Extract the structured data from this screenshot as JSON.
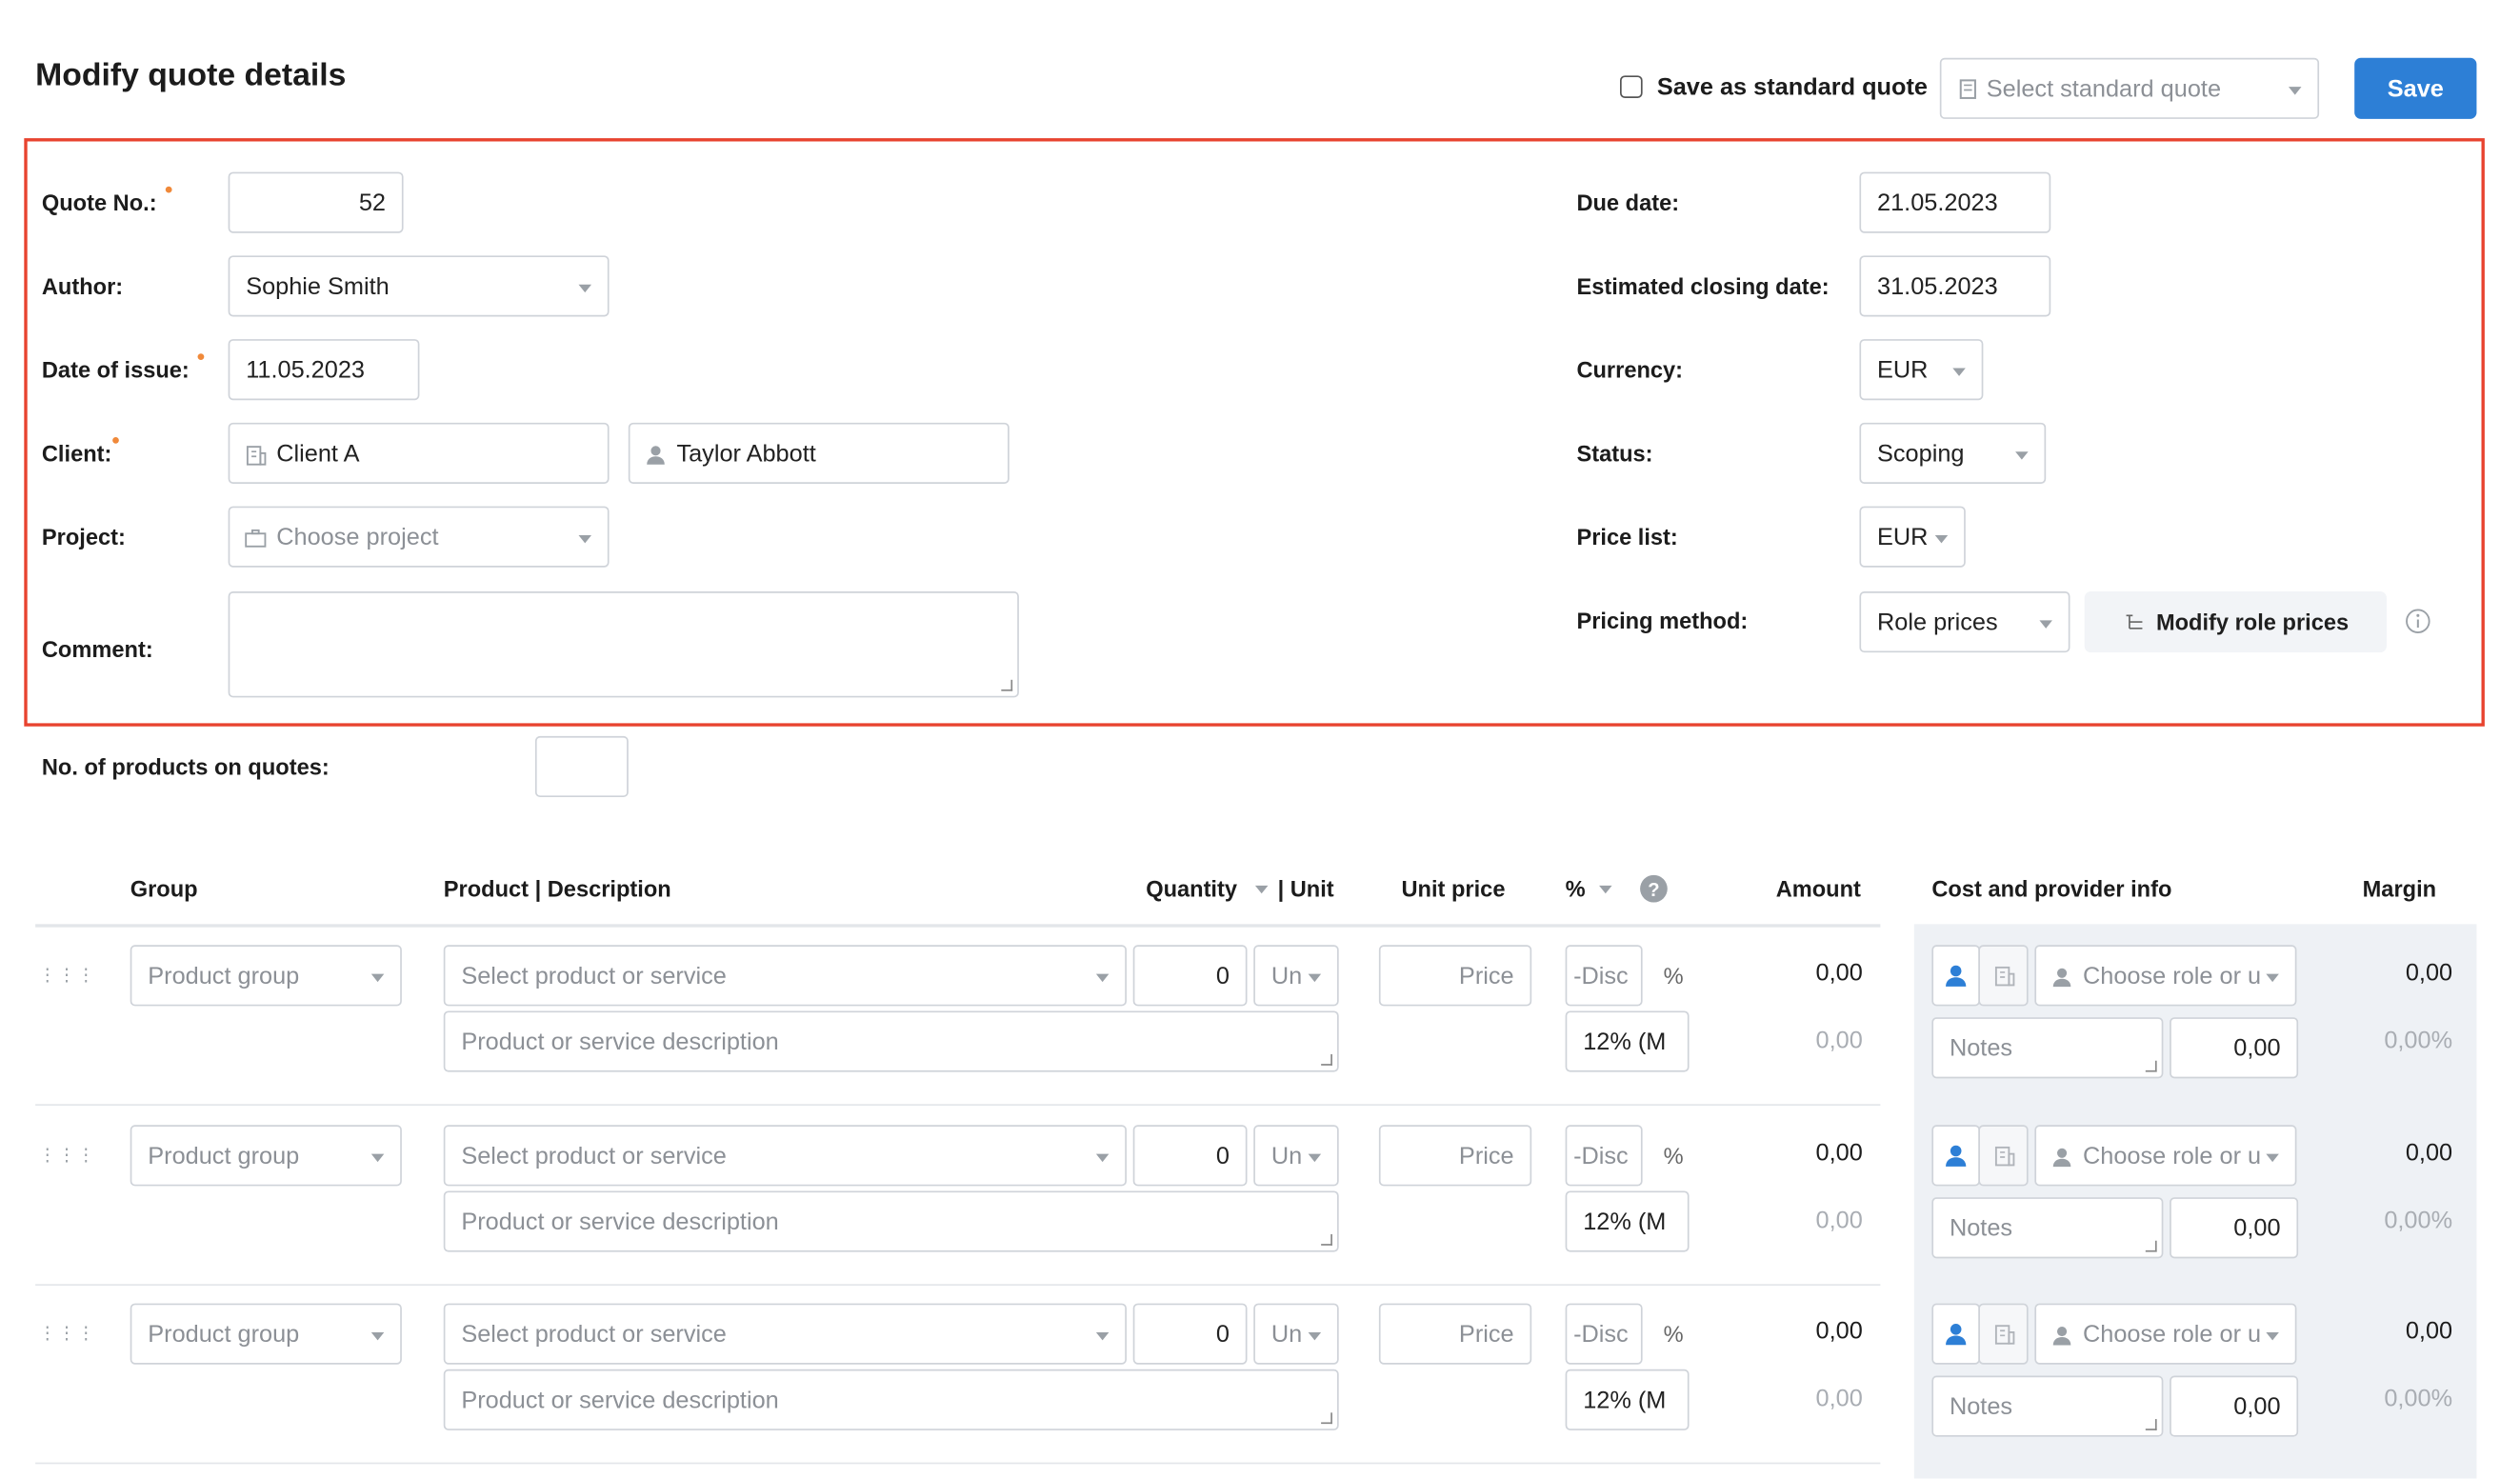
{
  "header": {
    "title": "Modify quote details",
    "save_standard_label": "Save as standard quote",
    "select_standard_placeholder": "Select standard quote",
    "save_label": "Save"
  },
  "form": {
    "quote_no_label": "Quote No.:",
    "quote_no_value": "52",
    "author_label": "Author:",
    "author_value": "Sophie Smith",
    "issue_label": "Date of issue:",
    "issue_value": "11.05.2023",
    "client_label": "Client:",
    "client_value": "Client A",
    "contact_value": "Taylor Abbott",
    "project_label": "Project:",
    "project_placeholder": "Choose project",
    "comment_label": "Comment:",
    "comment_value": "",
    "due_label": "Due date:",
    "due_value": "21.05.2023",
    "closing_label": "Estimated closing date:",
    "closing_value": "31.05.2023",
    "currency_label": "Currency:",
    "currency_value": "EUR",
    "status_label": "Status:",
    "status_value": "Scoping",
    "pricelist_label": "Price list:",
    "pricelist_value": "EUR",
    "pricing_label": "Pricing method:",
    "pricing_value": "Role prices",
    "modify_role_prices_label": "Modify role prices",
    "products_count_label": "No. of products on quotes:",
    "products_count_value": ""
  },
  "table": {
    "headers": {
      "group": "Group",
      "product": "Product | Description",
      "quantity": "Quantity",
      "unit": "| Unit",
      "unit_price": "Unit price",
      "percent": "%",
      "amount": "Amount",
      "cost": "Cost and provider info",
      "margin": "Margin"
    },
    "rows": [
      {
        "group_placeholder": "Product group",
        "product_placeholder": "Select product or service",
        "quantity": "0",
        "unit_placeholder": "Un",
        "description_placeholder": "Product or service description",
        "price_placeholder": "Price",
        "discount_placeholder": "-Disc",
        "percent_sign": "%",
        "vat": "12% (M",
        "amount": "0,00",
        "amount_sub": "0,00",
        "role_placeholder": "Choose role or u",
        "notes_placeholder": "Notes",
        "cost": "0,00",
        "margin": "0,00",
        "margin_pct": "0,00%"
      },
      {
        "group_placeholder": "Product group",
        "product_placeholder": "Select product or service",
        "quantity": "0",
        "unit_placeholder": "Un",
        "description_placeholder": "Product or service description",
        "price_placeholder": "Price",
        "discount_placeholder": "-Disc",
        "percent_sign": "%",
        "vat": "12% (M",
        "amount": "0,00",
        "amount_sub": "0,00",
        "role_placeholder": "Choose role or u",
        "notes_placeholder": "Notes",
        "cost": "0,00",
        "margin": "0,00",
        "margin_pct": "0,00%"
      },
      {
        "group_placeholder": "Product group",
        "product_placeholder": "Select product or service",
        "quantity": "0",
        "unit_placeholder": "Un",
        "description_placeholder": "Product or service description",
        "price_placeholder": "Price",
        "discount_placeholder": "-Disc",
        "percent_sign": "%",
        "vat": "12% (M",
        "amount": "0,00",
        "amount_sub": "0,00",
        "role_placeholder": "Choose role or u",
        "notes_placeholder": "Notes",
        "cost": "0,00",
        "margin": "0,00",
        "margin_pct": "0,00%"
      }
    ]
  },
  "colors": {
    "accent": "#2d7fd6",
    "highlight_frame": "#e8432f",
    "required_dot": "#f0893a",
    "cost_panel": "#eef1f5"
  },
  "icons": [
    "building-icon",
    "person-icon",
    "briefcase-icon",
    "document-icon",
    "info-icon",
    "help-icon",
    "drag-handle-icon",
    "chevron-down-icon"
  ]
}
